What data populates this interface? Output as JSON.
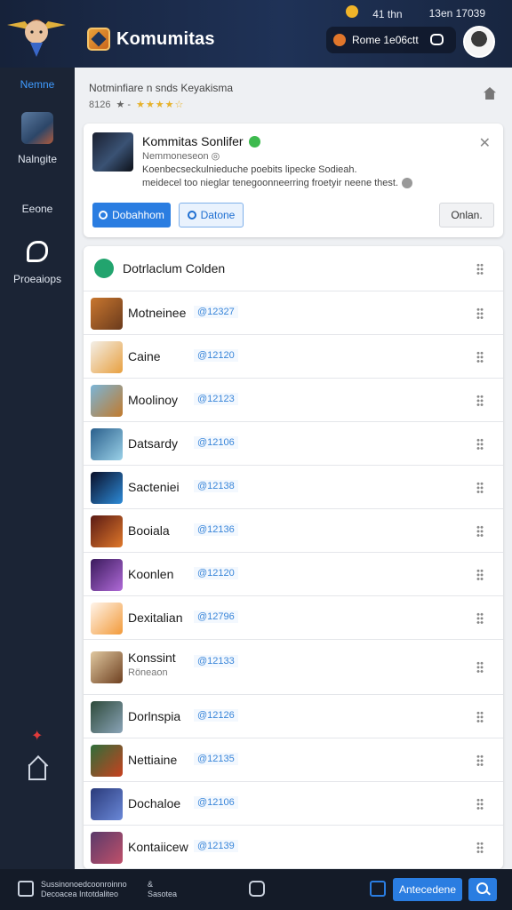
{
  "header": {
    "brand": "Komumitas",
    "status_time": "41 thn",
    "status_date": "13en 17039",
    "notification_label": "Rome 1e06ctt",
    "hero_icon": "hero-avatar-icon",
    "chat_icon": "chat-icon",
    "user_icon": "user-avatar"
  },
  "sidebar": {
    "items": [
      {
        "label": "Nemne",
        "active": true
      },
      {
        "label": "Nalngite"
      },
      {
        "label": "Eeone"
      },
      {
        "label": "Proeaiops"
      }
    ]
  },
  "main": {
    "top_title": "Notminfiare n snds Keyakisma",
    "top_meta": "8126",
    "top_stars": "★★★★☆",
    "card": {
      "title": "Kommitas Sonlifer",
      "meta": "Nemmoneseon  ◎",
      "desc_line1": "Koenbecseckulnieduche poebits lipecke Sodieah.",
      "desc_line2": "meidecel too nieglar tenegoonneerring froetyir neene thest.",
      "primary_button": "Dobahhom",
      "outline_button": "Datone",
      "ghost_button": "Onlan."
    },
    "list_header": "Dotrlaclum Colden",
    "rows": [
      {
        "name": "Motneinee",
        "id": "@12327",
        "sub": ""
      },
      {
        "name": "Caine",
        "id": "@12120",
        "sub": ""
      },
      {
        "name": "Moolinoy",
        "id": "@12123",
        "sub": ""
      },
      {
        "name": "Datsardy",
        "id": "@12106",
        "sub": ""
      },
      {
        "name": "Sacteniei",
        "id": "@12138",
        "sub": ""
      },
      {
        "name": "Booiala",
        "id": "@12136",
        "sub": ""
      },
      {
        "name": "Koonlen",
        "id": "@12120",
        "sub": ""
      },
      {
        "name": "Dexitalian",
        "id": "@12796",
        "sub": ""
      },
      {
        "name": "Konssint",
        "id": "@12133",
        "sub": "Röneaon"
      },
      {
        "name": "Dorlnspia",
        "id": "@12126",
        "sub": ""
      },
      {
        "name": "Nettiaine",
        "id": "@12135",
        "sub": ""
      },
      {
        "name": "Dochaloe",
        "id": "@12106",
        "sub": ""
      },
      {
        "name": "Kontaiicew",
        "id": "@12139",
        "sub": ""
      }
    ]
  },
  "bottom": {
    "left_text_1": "Sussinonoedcoonroinno",
    "left_text_2": "Decoacea Intotdaliteo",
    "mid_text_1": "&",
    "mid_text_2": "Sasotea",
    "action_button": "Antecedene"
  },
  "colors": {
    "accent": "#2a7de1",
    "sidebar_bg": "#1b2435",
    "header_bg": "#1f3257",
    "verified": "#3dba4e"
  }
}
